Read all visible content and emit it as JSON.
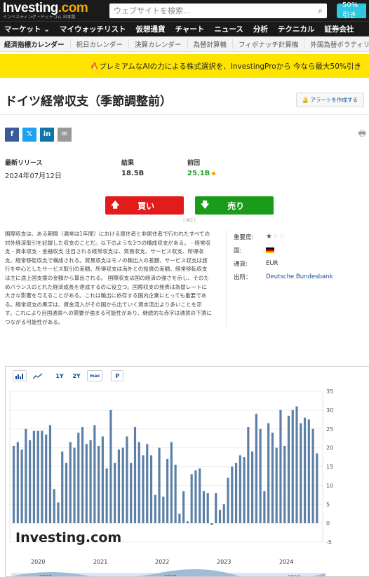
{
  "header": {
    "logo_text": "Investing",
    "logo_suffix": ".com",
    "logo_sub": "インベスティング・ドットコム 日本版",
    "search_placeholder": "ウェブサイトを検索...",
    "promo_pill": "50%引き"
  },
  "nav": [
    "マーケット",
    "マイウォッチリスト",
    "仮想通貨",
    "チャート",
    "ニュース",
    "分析",
    "テクニカル",
    "証券会社"
  ],
  "nav_arrow": "⌄",
  "subnav": [
    "経済指標カレンダー",
    "祝日カレンダー",
    "決算カレンダー",
    "為替計算機",
    "フィボナッチ計算機",
    "外国為替ボラティリ"
  ],
  "banner": "🔥プレミアムなAIの力による株式選択を、InvestingProから 今なら最大50%引き",
  "page_title": "ドイツ経常収支（季節調整前）",
  "alert_button": "アラートを作成する",
  "share": [
    {
      "icon": "facebook-icon",
      "glyph": "f",
      "color": "#3b5998"
    },
    {
      "icon": "twitter-icon",
      "glyph": "𝕏",
      "color": "#1da1f2"
    },
    {
      "icon": "linkedin-icon",
      "glyph": "in",
      "color": "#0e76a8"
    },
    {
      "icon": "email-icon",
      "glyph": "✉",
      "color": "#999999"
    }
  ],
  "stats": {
    "latest_label": "最新リリース",
    "latest_value": "2024年07月12日",
    "actual_label": "結果",
    "actual_value": "18.5B",
    "previous_label": "前回",
    "previous_value": "25.1B"
  },
  "trade": {
    "buy": "買い",
    "sell": "売り",
    "ad": "| AD |"
  },
  "description": "国際収支は、ある期間（通常は1年間）における居住者と非居住者で行われたすべての対外経済取引を記録した収支のことだ。以下のような3つの構成収支がある。 - 経常収支 - 資本収支 - 金融収支 注目される経常収支は、貿易収支、サービス収支、所得収支、経常移転収支で構成される。貿易収支はモノの輸出入の差額、サービス収支は旅行を中心としたサービス取引の差額、所得収支は海外との投資の差額、経常移転収支は主に途上国支援の金額から算出される。 国際収支は国の経済の強さを示し、そのためバランスのとれた経済成長を達成するのに役立つ。国際収支の発表は為替レートに大きな影響を与えることがある。これは輸出に依存する国内企業にとっても重要である。経常収支の黒字は、資金流入がその国から出ていく資本流出より多いことを示す。これにより自国通貨への需要が強まる可能性があり、継続的な赤字は通貨の下落につながる可能性がある。",
  "meta": {
    "importance_label": "重要度:",
    "importance_level": 1,
    "importance_max": 3,
    "country_label": "国:",
    "currency_label": "通貨:",
    "currency_value": "EUR",
    "source_label": "出所：",
    "source_value": "Deutsche Bundesbank"
  },
  "chart_toolbar": {
    "bar_icon": "bar-chart-icon",
    "line_icon": "line-chart-icon",
    "r1": "1Y",
    "r2": "2Y",
    "rmax": "max",
    "p": "P"
  },
  "chart_data": {
    "type": "bar",
    "watermark": "Investing.com",
    "ylim": [
      -5,
      35
    ],
    "yticks": [
      35,
      30,
      25,
      20,
      15,
      10,
      5,
      0,
      -5
    ],
    "x_labels": [
      "2020",
      "2021",
      "2022",
      "2023",
      "2024"
    ],
    "nav_labels": [
      "2020",
      "2022",
      "2024"
    ],
    "series_color": "#5b7fa6",
    "values": [
      20.5,
      21.5,
      19.5,
      25,
      22,
      24.5,
      24.5,
      24.5,
      23.5,
      26,
      9,
      5.5,
      19,
      16,
      21.5,
      20,
      24,
      25.5,
      21,
      22,
      26,
      20.5,
      23,
      14.5,
      30,
      16,
      19.5,
      20,
      23,
      16,
      25.5,
      21.5,
      18,
      21,
      18,
      7.5,
      20,
      7,
      17,
      21.5,
      15.5,
      2.5,
      8.5,
      0.5,
      13,
      14,
      14.5,
      8.5,
      8,
      -0.5,
      8,
      3.5,
      5,
      12,
      15,
      16,
      18,
      17.5,
      25.5,
      19,
      29,
      25,
      8.5,
      26.5,
      24,
      20,
      30,
      20.5,
      28.5,
      30,
      31,
      26.5,
      28,
      27.5,
      25,
      18.5
    ]
  }
}
